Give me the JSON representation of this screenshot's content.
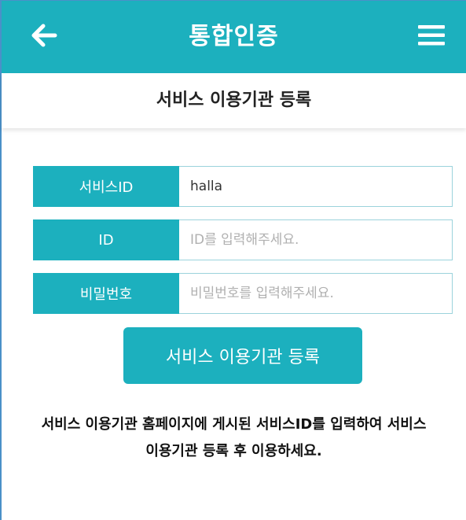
{
  "header": {
    "title": "통합인증",
    "back_icon": "arrow-left-icon",
    "menu_icon": "hamburger-menu-icon",
    "background_color": "#1cb0be"
  },
  "subheader": {
    "title": "서비스 이용기관 등록"
  },
  "form": {
    "service_id": {
      "label": "서비스ID",
      "value": "halla",
      "placeholder": ""
    },
    "user_id": {
      "label": "ID",
      "value": "",
      "placeholder": "ID를 입력해주세요."
    },
    "password": {
      "label": "비밀번호",
      "value": "",
      "placeholder": "비밀번호를 입력해주세요."
    }
  },
  "submit_button": {
    "label": "서비스 이용기관 등록"
  },
  "notice": {
    "line1": "서비스 이용기관 홈페이지에 게시된 서비스ID를 입력하여 서비스",
    "line2": "이용기관 등록 후 이용하세요."
  }
}
